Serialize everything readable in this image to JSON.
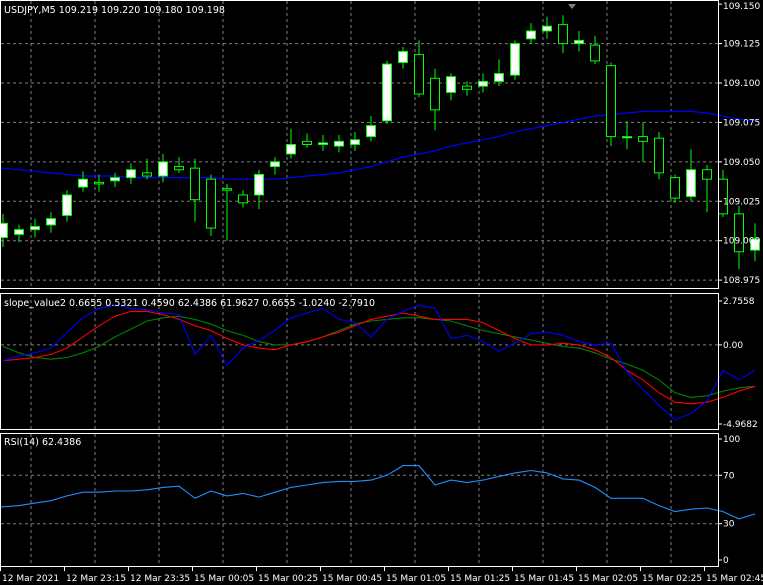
{
  "colors": {
    "background": "#000000",
    "grid": "#7f7f7f",
    "frame": "#ffffff",
    "bull_candle": "#ffffff",
    "bear_candle": "#000000",
    "candle_wick": "#00ff00",
    "moving_average": "#0000ff",
    "slope_line_1": "#0000ff",
    "slope_line_2": "#ff0000",
    "slope_line_3": "#008000",
    "rsi_line": "#1e90ff"
  },
  "main_chart": {
    "header": "USDJPY,M5  109.219 109.220 109.180 109.198",
    "price_labels": [
      "109.150",
      "109.125",
      "109.100",
      "109.075",
      "109.050",
      "109.025",
      "109.000",
      "108.975"
    ]
  },
  "slope_panel": {
    "header": "slope_value2 0.6655 0.5321 0.4590 62.4386 61.9627 0.6655 -1.0240 -2.7910",
    "scale_labels": [
      "2.7558",
      "0.00",
      "-4.9682"
    ]
  },
  "rsi_panel": {
    "header": "RSI(14) 62.4386",
    "scale_labels": [
      "100",
      "70",
      "30",
      "0"
    ]
  },
  "time_axis": {
    "labels": [
      "12 Mar 2021",
      "12 Mar 23:15",
      "12 Mar 23:35",
      "15 Mar 00:05",
      "15 Mar 00:25",
      "15 Mar 00:45",
      "15 Mar 01:05",
      "15 Mar 01:25",
      "15 Mar 01:45",
      "15 Mar 02:05",
      "15 Mar 02:25",
      "15 Mar 02:45"
    ]
  },
  "chart_data": [
    {
      "type": "candlestick",
      "title": "USDJPY,M5",
      "price_range": [
        108.97,
        109.152
      ],
      "candles": [
        {
          "o": 109.002,
          "h": 109.017,
          "l": 108.996,
          "c": 109.011
        },
        {
          "o": 109.004,
          "h": 109.01,
          "l": 108.999,
          "c": 109.007
        },
        {
          "o": 109.007,
          "h": 109.014,
          "l": 109.002,
          "c": 109.009
        },
        {
          "o": 109.01,
          "h": 109.018,
          "l": 109.005,
          "c": 109.014
        },
        {
          "o": 109.016,
          "h": 109.032,
          "l": 109.012,
          "c": 109.029
        },
        {
          "o": 109.034,
          "h": 109.044,
          "l": 109.031,
          "c": 109.039
        },
        {
          "o": 109.037,
          "h": 109.042,
          "l": 109.031,
          "c": 109.036
        },
        {
          "o": 109.038,
          "h": 109.043,
          "l": 109.034,
          "c": 109.04
        },
        {
          "o": 109.04,
          "h": 109.049,
          "l": 109.036,
          "c": 109.045
        },
        {
          "o": 109.043,
          "h": 109.052,
          "l": 109.039,
          "c": 109.041
        },
        {
          "o": 109.041,
          "h": 109.055,
          "l": 109.037,
          "c": 109.05
        },
        {
          "o": 109.047,
          "h": 109.053,
          "l": 109.043,
          "c": 109.045
        },
        {
          "o": 109.046,
          "h": 109.052,
          "l": 109.012,
          "c": 109.026
        },
        {
          "o": 109.039,
          "h": 109.042,
          "l": 109.003,
          "c": 109.008
        },
        {
          "o": 109.033,
          "h": 109.036,
          "l": 109.0,
          "c": 109.032
        },
        {
          "o": 109.029,
          "h": 109.032,
          "l": 109.021,
          "c": 109.024
        },
        {
          "o": 109.029,
          "h": 109.045,
          "l": 109.02,
          "c": 109.042
        },
        {
          "o": 109.047,
          "h": 109.053,
          "l": 109.042,
          "c": 109.05
        },
        {
          "o": 109.055,
          "h": 109.071,
          "l": 109.052,
          "c": 109.061
        },
        {
          "o": 109.063,
          "h": 109.068,
          "l": 109.059,
          "c": 109.061
        },
        {
          "o": 109.061,
          "h": 109.067,
          "l": 109.057,
          "c": 109.062
        },
        {
          "o": 109.06,
          "h": 109.067,
          "l": 109.056,
          "c": 109.063
        },
        {
          "o": 109.061,
          "h": 109.069,
          "l": 109.057,
          "c": 109.064
        },
        {
          "o": 109.066,
          "h": 109.079,
          "l": 109.063,
          "c": 109.073
        },
        {
          "o": 109.076,
          "h": 109.114,
          "l": 109.074,
          "c": 109.112
        },
        {
          "o": 109.113,
          "h": 109.123,
          "l": 109.109,
          "c": 109.12
        },
        {
          "o": 109.118,
          "h": 109.127,
          "l": 109.091,
          "c": 109.093
        },
        {
          "o": 109.103,
          "h": 109.109,
          "l": 109.07,
          "c": 109.083
        },
        {
          "o": 109.094,
          "h": 109.106,
          "l": 109.089,
          "c": 109.104
        },
        {
          "o": 109.098,
          "h": 109.101,
          "l": 109.092,
          "c": 109.096
        },
        {
          "o": 109.098,
          "h": 109.106,
          "l": 109.094,
          "c": 109.101
        },
        {
          "o": 109.101,
          "h": 109.115,
          "l": 109.098,
          "c": 109.106
        },
        {
          "o": 109.105,
          "h": 109.127,
          "l": 109.102,
          "c": 109.125
        },
        {
          "o": 109.128,
          "h": 109.138,
          "l": 109.125,
          "c": 109.133
        },
        {
          "o": 109.133,
          "h": 109.142,
          "l": 109.128,
          "c": 109.136
        },
        {
          "o": 109.137,
          "h": 109.143,
          "l": 109.119,
          "c": 109.125
        },
        {
          "o": 109.125,
          "h": 109.133,
          "l": 109.12,
          "c": 109.127
        },
        {
          "o": 109.124,
          "h": 109.13,
          "l": 109.112,
          "c": 109.114
        },
        {
          "o": 109.111,
          "h": 109.113,
          "l": 109.06,
          "c": 109.066
        },
        {
          "o": 109.066,
          "h": 109.076,
          "l": 109.058,
          "c": 109.066
        },
        {
          "o": 109.066,
          "h": 109.075,
          "l": 109.05,
          "c": 109.063
        },
        {
          "o": 109.065,
          "h": 109.069,
          "l": 109.039,
          "c": 109.043
        },
        {
          "o": 109.04,
          "h": 109.042,
          "l": 109.024,
          "c": 109.027
        },
        {
          "o": 109.028,
          "h": 109.058,
          "l": 109.025,
          "c": 109.045
        },
        {
          "o": 109.045,
          "h": 109.048,
          "l": 109.018,
          "c": 109.039
        },
        {
          "o": 109.039,
          "h": 109.045,
          "l": 109.015,
          "c": 109.017
        },
        {
          "o": 109.017,
          "h": 109.022,
          "l": 108.982,
          "c": 108.993
        },
        {
          "o": 108.994,
          "h": 109.011,
          "l": 108.987,
          "c": 109.001
        }
      ],
      "moving_average": [
        109.046,
        109.045,
        109.044,
        109.043,
        109.042,
        109.041,
        109.041,
        109.041,
        109.04,
        109.04,
        109.04,
        109.04,
        109.04,
        109.04,
        109.039,
        109.039,
        109.039,
        109.039,
        109.04,
        109.041,
        109.042,
        109.043,
        109.045,
        109.047,
        109.05,
        109.053,
        109.055,
        109.057,
        109.06,
        109.062,
        109.064,
        109.066,
        109.069,
        109.071,
        109.073,
        109.075,
        109.077,
        109.079,
        109.08,
        109.081,
        109.082,
        109.082,
        109.082,
        109.082,
        109.081,
        109.079,
        109.077,
        109.076
      ]
    },
    {
      "type": "line",
      "title": "slope_value2",
      "ylim": [
        -4.9682,
        2.7558
      ],
      "series": [
        {
          "values": [
            -1.0,
            -0.7,
            -0.5,
            -0.2,
            0.8,
            1.7,
            2.3,
            2.5,
            2.3,
            2.2,
            2.0,
            1.9,
            -0.6,
            0.6,
            -1.3,
            -0.2,
            0.3,
            0.9,
            1.7,
            2.0,
            2.3,
            1.6,
            1.4,
            0.5,
            1.6,
            2.1,
            2.5,
            2.3,
            0.4,
            0.6,
            0.2,
            -0.4,
            0.1,
            0.7,
            0.8,
            0.6,
            0.2,
            0.0,
            0.1,
            -1.7,
            -2.8,
            -3.8,
            -4.7,
            -4.3,
            -3.5,
            -1.6,
            -2.2,
            -1.6
          ]
        },
        {
          "values": [
            -1.0,
            -0.9,
            -0.8,
            -0.6,
            -0.2,
            0.5,
            1.2,
            1.8,
            2.1,
            2.1,
            1.9,
            1.6,
            1.2,
            0.9,
            0.4,
            0.0,
            -0.2,
            -0.3,
            0.0,
            0.2,
            0.5,
            0.8,
            1.2,
            1.6,
            1.8,
            2.0,
            1.8,
            1.6,
            1.6,
            1.6,
            1.4,
            0.9,
            0.4,
            0.0,
            0.0,
            0.1,
            0.0,
            -0.3,
            -0.8,
            -1.6,
            -2.2,
            -3.0,
            -3.6,
            -3.7,
            -3.6,
            -3.3,
            -2.9,
            -2.6
          ]
        },
        {
          "values": [
            -0.1,
            -0.5,
            -0.8,
            -0.9,
            -0.8,
            -0.5,
            -0.1,
            0.5,
            1.0,
            1.5,
            1.7,
            1.8,
            1.6,
            1.3,
            0.9,
            0.6,
            0.2,
            0.0,
            0.0,
            0.2,
            0.5,
            0.9,
            1.3,
            1.5,
            1.6,
            1.7,
            1.7,
            1.6,
            1.5,
            1.2,
            0.9,
            0.7,
            0.5,
            0.3,
            0.1,
            -0.1,
            -0.2,
            -0.5,
            -0.9,
            -1.2,
            -1.6,
            -2.2,
            -3.0,
            -3.3,
            -3.2,
            -2.9,
            -2.7,
            -2.6
          ]
        }
      ]
    },
    {
      "type": "line",
      "title": "RSI(14)",
      "ylim": [
        0,
        100
      ],
      "series": [
        {
          "values": [
            44,
            45,
            47,
            49,
            53,
            56,
            56,
            57,
            57,
            58,
            60,
            61,
            51,
            57,
            53,
            55,
            52,
            56,
            60,
            62,
            64,
            65,
            65,
            66,
            70,
            78,
            78,
            62,
            66,
            64,
            66,
            69,
            72,
            74,
            72,
            67,
            66,
            60,
            51,
            51,
            51,
            45,
            40,
            42,
            43,
            40,
            34,
            38
          ]
        }
      ]
    }
  ]
}
